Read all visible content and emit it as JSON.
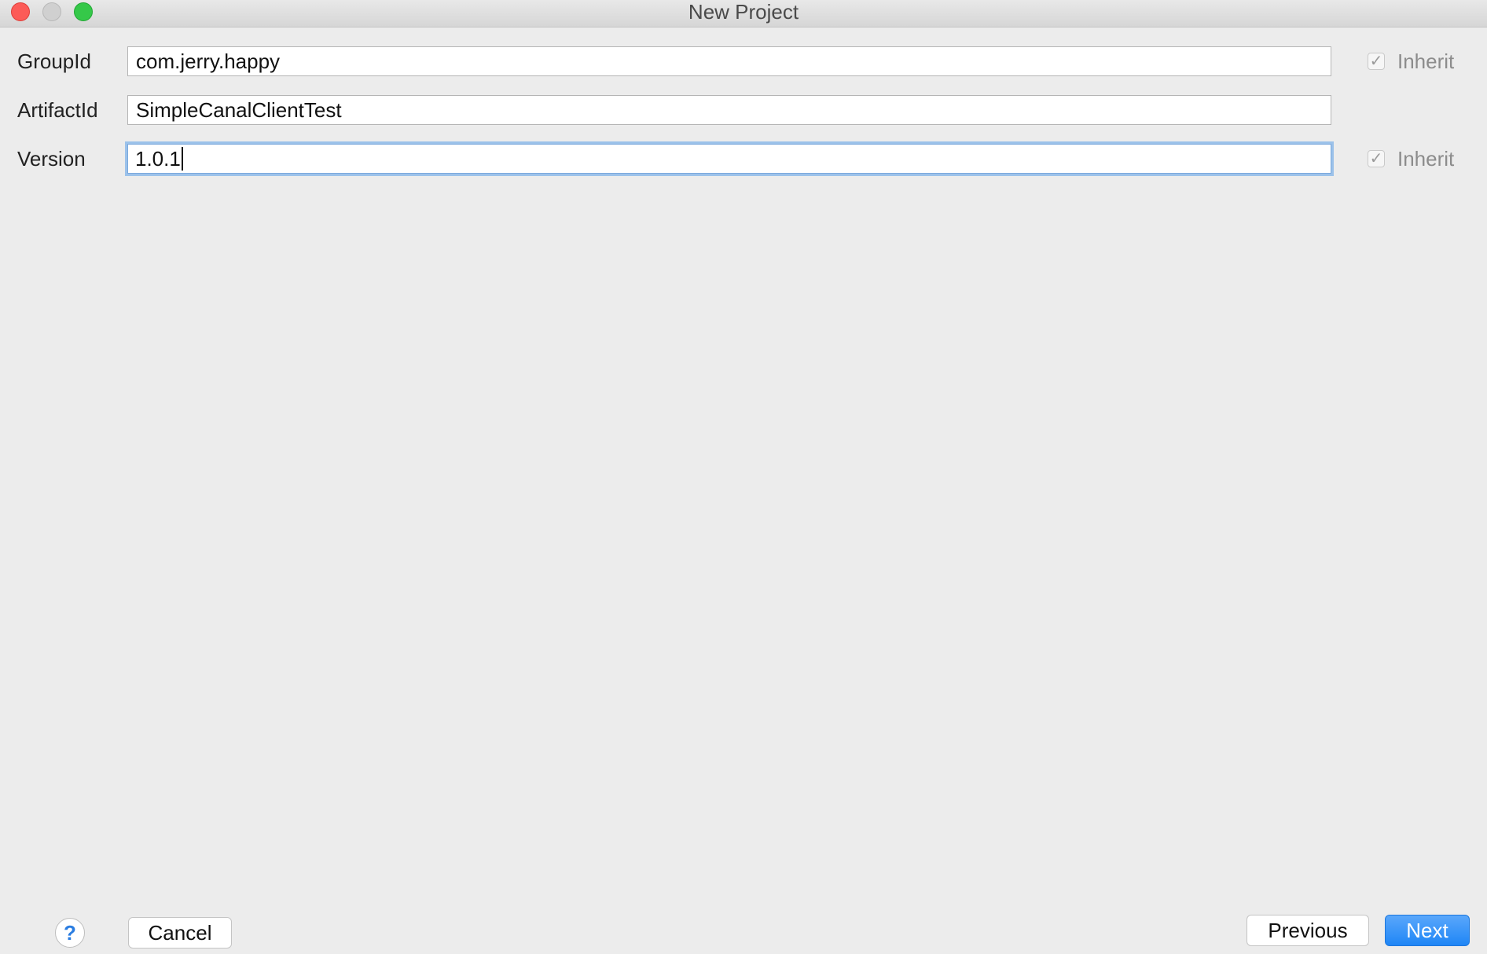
{
  "window": {
    "title": "New Project"
  },
  "form": {
    "group_id": {
      "label": "GroupId",
      "value": "com.jerry.happy",
      "inherit_label": "Inherit",
      "inherit_checked": true
    },
    "artifact_id": {
      "label": "ArtifactId",
      "value": "SimpleCanalClientTest"
    },
    "version": {
      "label": "Version",
      "value": "1.0.1",
      "inherit_label": "Inherit",
      "inherit_checked": true
    }
  },
  "footer": {
    "help_label": "?",
    "cancel_label": "Cancel",
    "previous_label": "Previous",
    "next_label": "Next"
  },
  "colors": {
    "accent": "#1f86f6",
    "focus_ring": "#9cc2ea",
    "close": "#fc5b57",
    "zoom": "#35c849"
  },
  "icons": {
    "checkmark": "checkmark-icon",
    "help": "question-icon"
  }
}
